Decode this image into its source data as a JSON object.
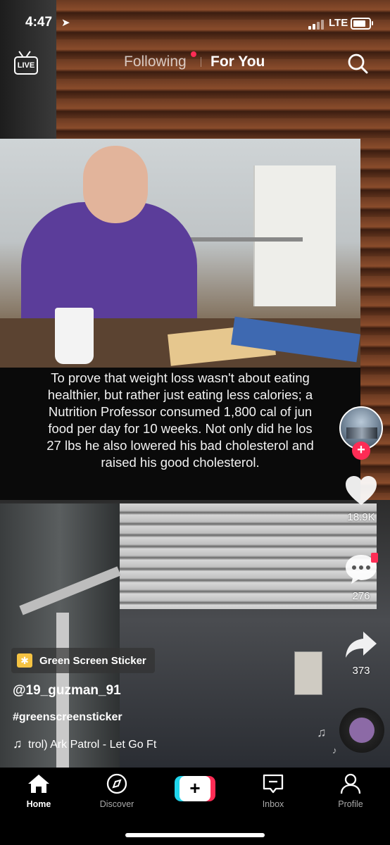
{
  "status_bar": {
    "time": "4:47",
    "network": "LTE"
  },
  "top_tabs": {
    "live_label": "LIVE",
    "following": "Following",
    "for_you": "For You"
  },
  "video": {
    "caption": "To prove that weight loss wasn't about eating\nhealthier, but rather just eating less calories; a\nNutrition Professor consumed 1,800 cal of jun\nfood per day for 10 weeks. Not only did he los\n27 lbs he also lowered his bad cholesterol and\nraised his good cholesterol."
  },
  "actions": {
    "likes": "18.9K",
    "comments": "276",
    "shares": "373",
    "follow_symbol": "+"
  },
  "post": {
    "sticker_label": "Green Screen Sticker",
    "username": "@19_guzman_91",
    "hashtag": "#greenscreensticker",
    "music": "trol)     Ark Patrol - Let Go Ft"
  },
  "nav": {
    "home": "Home",
    "discover": "Discover",
    "create": "+",
    "inbox": "Inbox",
    "profile": "Profile"
  },
  "colors": {
    "accent": "#fe2c55",
    "cyan": "#20d5ec"
  }
}
